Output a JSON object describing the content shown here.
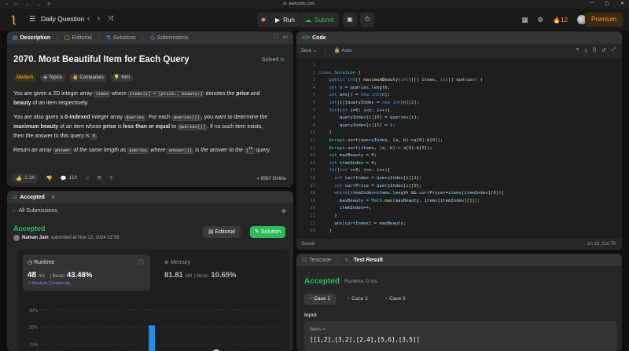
{
  "browser": {
    "url": "leetcode.com"
  },
  "nav": {
    "list_title": "Daily Question",
    "run_label": "Run",
    "submit_label": "Submit",
    "streak": "12",
    "premium_label": "Premium"
  },
  "description": {
    "tabs": [
      {
        "label": "Description"
      },
      {
        "label": "Editorial"
      },
      {
        "label": "Solutions"
      },
      {
        "label": "Submissions"
      }
    ],
    "title": "2070. Most Beautiful Item for Each Query",
    "status": "Solved",
    "chips": [
      "Medium",
      "Topics",
      "Companies",
      "Hint"
    ],
    "p1": {
      "a": "You are given a 2D integer array ",
      "c1": "items",
      "b": " where ",
      "c2": "items[i] = [priceᵢ, beautyᵢ]",
      "c": " denotes the ",
      "s1": "price",
      "d": " and",
      "s2": "beauty",
      "e": " of an item respectively."
    },
    "p2": {
      "a": "You are also given a ",
      "s1": "0-indexed",
      "b": " integer array ",
      "c1": "queries",
      "c": ". For each ",
      "c2": "queries[j]",
      "d": ", you want to determine the",
      "s2": "maximum beauty",
      "e": " of an item whose ",
      "s3": "price",
      "f": " is ",
      "s4": "less than or equal",
      "g": " to ",
      "c3": "queries[j]",
      "h": ". If no such item exists,",
      "i": "then the answer to this query is ",
      "c4": "0",
      "j": "."
    },
    "p3": {
      "a": "Return ",
      "i1": "an array ",
      "c1": "answer",
      "i2": " of the same length as ",
      "c2": "queries",
      "i3": " where ",
      "c3": "answer[j]",
      "i4": " is the answer to the ",
      "sup": "th",
      "i5": " query."
    },
    "footer": {
      "likes": "1.1K",
      "comments": "116",
      "online": "6567 Online"
    }
  },
  "submission": {
    "tab_label": "Accepted",
    "back_label": "All Submissions",
    "status": "Accepted",
    "user": "Naman Jain",
    "submitted_text": "submitted at Nov 12, 2024 22:58",
    "editorial_btn": "Editorial",
    "solution_btn": "Solution",
    "runtime": {
      "label": "Runtime",
      "value": "48",
      "unit": "ms",
      "beats_label": "Beats",
      "beats": "43.48%",
      "analyze": "Analyze Complexity"
    },
    "memory": {
      "label": "Memory",
      "value": "81.81",
      "unit": "MB",
      "beats_label": "Beats",
      "beats": "10.65%"
    }
  },
  "chart_data": {
    "type": "bar",
    "title": "",
    "xlabel": "",
    "ylabel": "",
    "y_ticks": [
      "30%",
      "20%",
      "10%"
    ],
    "ylim": [
      0,
      35
    ],
    "bars": [
      {
        "x": 0.38,
        "value": 1.5
      },
      {
        "x": 0.45,
        "value": 21
      }
    ],
    "highlight_x": 0.73
  },
  "code": {
    "tab_label": "Code",
    "language": "Java",
    "mode": "Auto",
    "status_left": "Saved",
    "status_right": "Ln 18, Col 70",
    "lines": [
      "",
      "class Solution {",
      "    public int[] maximumBeauty(int[][] items, int[] queries) {",
      "    int n = queries.length;",
      "    int ans[] = new int[n];",
      "    int[][]queryIndex = new int[n][2];",
      "    for(int i=0; i<n; i++){",
      "        queryIndex[i][0] = queries[i];",
      "        queryIndex[i][1] = i;",
      "    }",
      "    Arrays.sort(queryIndex, (a, b)->a[0]-b[0]);",
      "    Arrays.sort(items, (a, b)-> a[0]-b[0]);",
      "    int maxBeauty = 0;",
      "    int itemIndex = 0;",
      "    for(int i=0; i<n; i++){",
      "      int currIndex = queryIndex[i][1];",
      "      int currPrice = queryIndex[i][0];",
      "      while(itemIndex<items.length && currPrice>=items[itemIndex][0]){",
      "        maxBeauty = Math.max(maxBeauty, items[itemIndex][1]);",
      "        itemIndex++;",
      "      }",
      "      ans[currIndex] = maxBeauty;",
      "    }"
    ]
  },
  "test": {
    "tabs": [
      {
        "label": "Testcase"
      },
      {
        "label": "Test Result"
      }
    ],
    "status": "Accepted",
    "runtime_text": "Runtime: 0 ms",
    "cases": [
      "Case 1",
      "Case 2",
      "Case 3"
    ],
    "input_label": "Input",
    "var_name": "items =",
    "var_value": "[[1,2],[3,2],[2,4],[5,6],[3,5]]"
  }
}
